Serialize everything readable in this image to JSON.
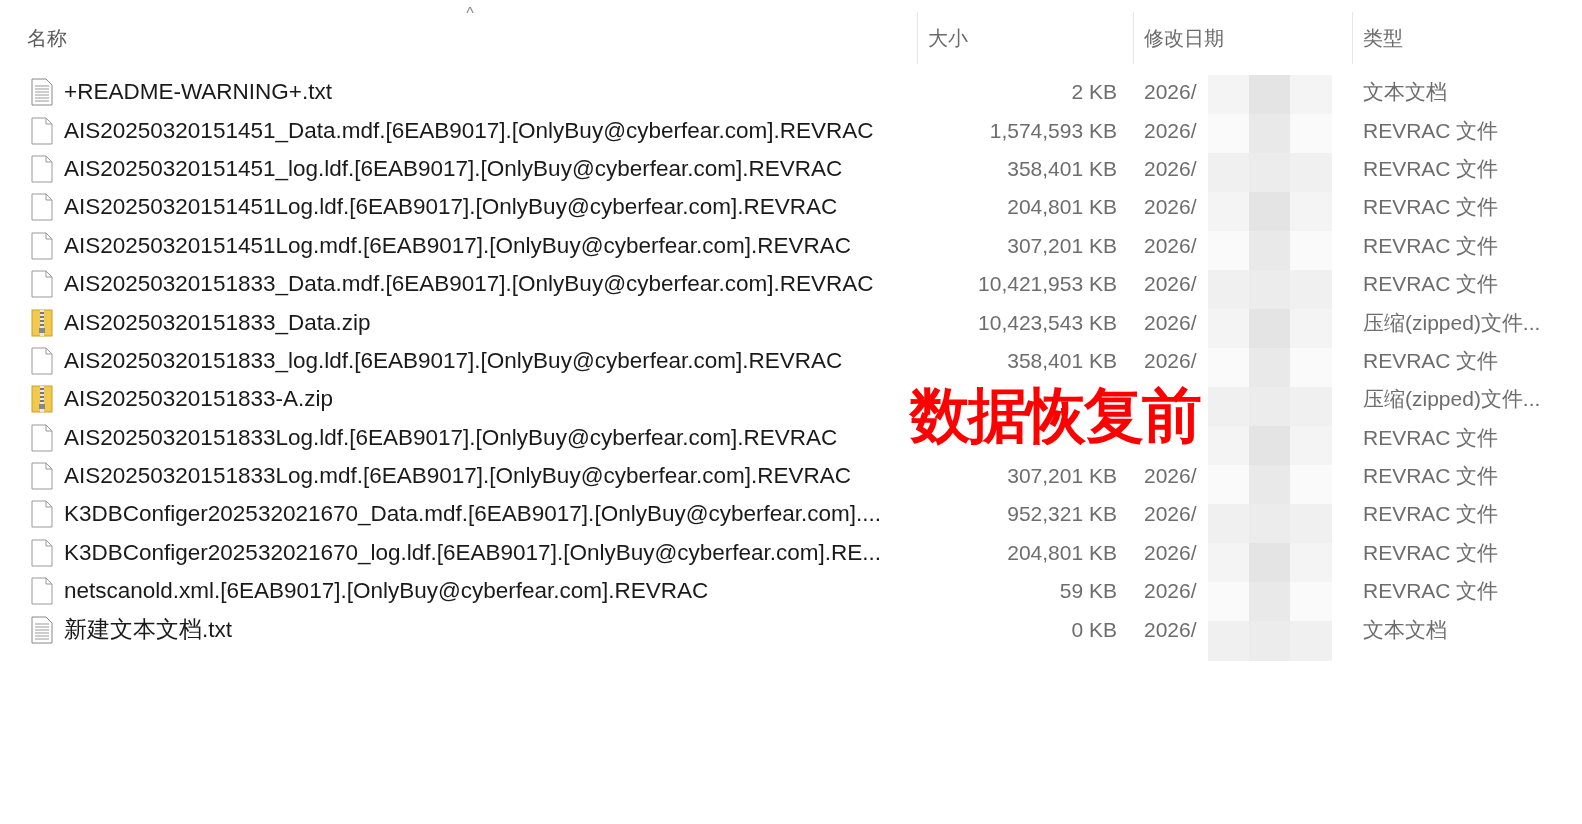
{
  "columns": [
    {
      "label": "名称",
      "sorted": true
    },
    {
      "label": "大小",
      "sorted": false
    },
    {
      "label": "修改日期",
      "sorted": false
    },
    {
      "label": "类型",
      "sorted": false
    }
  ],
  "sort_indicator": "^",
  "files": [
    {
      "kind": "text",
      "name": "+README-WARNING+.txt",
      "size": "2 KB",
      "date": "2026/",
      "type": "文本文档"
    },
    {
      "kind": "blank",
      "name": "AIS20250320151451_Data.mdf.[6EAB9017].[OnlyBuy@cyberfear.com].REVRAC",
      "size": "1,574,593 KB",
      "date": "2026/",
      "type": "REVRAC 文件"
    },
    {
      "kind": "blank",
      "name": "AIS20250320151451_log.ldf.[6EAB9017].[OnlyBuy@cyberfear.com].REVRAC",
      "size": "358,401 KB",
      "date": "2026/",
      "type": "REVRAC 文件"
    },
    {
      "kind": "blank",
      "name": "AIS20250320151451Log.ldf.[6EAB9017].[OnlyBuy@cyberfear.com].REVRAC",
      "size": "204,801 KB",
      "date": "2026/",
      "type": "REVRAC 文件"
    },
    {
      "kind": "blank",
      "name": "AIS20250320151451Log.mdf.[6EAB9017].[OnlyBuy@cyberfear.com].REVRAC",
      "size": "307,201 KB",
      "date": "2026/",
      "type": "REVRAC 文件"
    },
    {
      "kind": "blank",
      "name": "AIS20250320151833_Data.mdf.[6EAB9017].[OnlyBuy@cyberfear.com].REVRAC",
      "size": "10,421,953 KB",
      "date": "2026/",
      "type": "REVRAC 文件"
    },
    {
      "kind": "zip",
      "name": "AIS20250320151833_Data.zip",
      "size": "10,423,543 KB",
      "date": "2026/",
      "type": "压缩(zipped)文件..."
    },
    {
      "kind": "blank",
      "name": "AIS20250320151833_log.ldf.[6EAB9017].[OnlyBuy@cyberfear.com].REVRAC",
      "size": "358,401 KB",
      "date": "2026/",
      "type": "REVRAC 文件"
    },
    {
      "kind": "zip",
      "name": "AIS20250320151833-A.zip",
      "type": "压缩(zipped)文件..."
    },
    {
      "kind": "blank",
      "name": "AIS20250320151833Log.ldf.[6EAB9017].[OnlyBuy@cyberfear.com].REVRAC",
      "type": "REVRAC 文件"
    },
    {
      "kind": "blank",
      "name": "AIS20250320151833Log.mdf.[6EAB9017].[OnlyBuy@cyberfear.com].REVRAC",
      "size": "307,201 KB",
      "date": "2026/",
      "type": "REVRAC 文件"
    },
    {
      "kind": "blank",
      "name": "K3DBConfiger202532021670_Data.mdf.[6EAB9017].[OnlyBuy@cyberfear.com]....",
      "size": "952,321 KB",
      "date": "2026/",
      "type": "REVRAC 文件"
    },
    {
      "kind": "blank",
      "name": "K3DBConfiger202532021670_log.ldf.[6EAB9017].[OnlyBuy@cyberfear.com].RE...",
      "size": "204,801 KB",
      "date": "2026/",
      "type": "REVRAC 文件"
    },
    {
      "kind": "blank",
      "name": "netscanold.xml.[6EAB9017].[OnlyBuy@cyberfear.com].REVRAC",
      "size": "59 KB",
      "date": "2026/",
      "type": "REVRAC 文件"
    },
    {
      "kind": "text",
      "name": "新建文本文档.txt",
      "size": "0 KB",
      "date": "2026/",
      "type": "文本文档"
    }
  ],
  "annotation": "数据恢复前"
}
